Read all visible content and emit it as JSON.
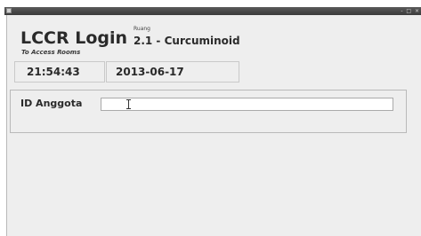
{
  "app": {
    "title": "LCCR Login",
    "subtitle": "To Access Rooms"
  },
  "room": {
    "label": "Ruang",
    "value": "2.1 - Curcuminoid"
  },
  "clock": {
    "time": "21:54:43",
    "date": "2013-06-17"
  },
  "login": {
    "id_label": "ID Anggota",
    "id_value": ""
  },
  "window": {
    "controls_glyphs": "- □ ×"
  },
  "icons": {
    "window": "app-window-icon",
    "cursor": "text-cursor-ibeam-icon"
  },
  "colors": {
    "titlebar": "#4a4a4a",
    "window_bg": "#eeeeee",
    "text": "#2a2a2a"
  }
}
